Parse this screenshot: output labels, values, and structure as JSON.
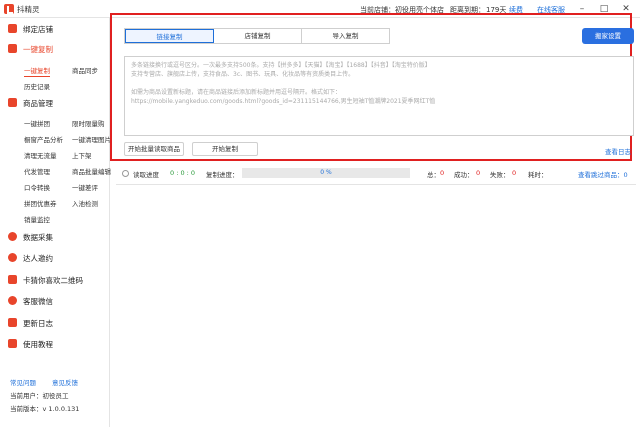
{
  "app": {
    "title": "抖精灵"
  },
  "titlebar": {
    "current_shop_label": "当前店铺：初役用亮个体店",
    "expire_label": "距离到期：",
    "expire_days": "179天",
    "renew": "续费",
    "online_service": "在线客服"
  },
  "sidebar": {
    "bind_shop": "绑定店铺",
    "one_click_copy": "一键复制",
    "copy_subs": [
      "一键复制",
      "商品同步",
      "历史记录"
    ],
    "product_manage": "商品管理",
    "product_subs": [
      [
        "一键拼团",
        "限时限量购"
      ],
      [
        "橱窗产品分析",
        "一键清理图片"
      ],
      [
        "清理无流量",
        "上下架"
      ],
      [
        "代发管理",
        "商品批量编辑"
      ],
      [
        "口令转换",
        "一键差评"
      ],
      [
        "拼团优惠券",
        "入池检测"
      ],
      [
        "销量监控",
        ""
      ]
    ],
    "data_collect": "数据采集",
    "talent_invite": "达人邀约",
    "qrcode": "卡猜你喜欢二维码",
    "service_wechat": "客服微信",
    "update_log": "更新日志",
    "tutorial": "使用教程",
    "faq": "常见问题",
    "feedback": "意见反馈",
    "current_user": "当前用户：初役员工",
    "version": "当前版本：v 1.0.0.131"
  },
  "main": {
    "tabs": [
      "链接复制",
      "店铺复制",
      "导入复制"
    ],
    "move_setting": "搬家设置",
    "textarea_placeholder": [
      "多条链接换行或逗号区分。一次最多支持500条。支持【拼多多】【天猫】【淘宝】【1688】【抖音】【淘宝特价版】",
      "支持专营店、旗舰店上传，支持食品、3c、图书、玩具、化妆品等有资质类目上传。",
      "",
      "如需为商品设置新标题，请在商品链接后添加新标题并用逗号隔开。格式如下：",
      "https://mobile.yangkeduo.com/goods.html?goods_id=231115144766,男生短袖T恤潮牌2021夏季网红T恤"
    ],
    "batch_read_button": "开始批量读取商品",
    "start_copy_button": "开始复制",
    "view_log": "查看日志",
    "progress": {
      "read_label": "读取进度",
      "read_value": "0 : 0 : 0",
      "copy_label": "复制进度：",
      "copy_percent": "0 %",
      "total_label": "总：",
      "total": "0",
      "success_label": "成功：",
      "success": "0",
      "fail_label": "失败：",
      "fail": "0",
      "time_label": "耗时：",
      "time": "",
      "skipped_link": "查看跳过商品：0"
    }
  },
  "colors": {
    "accent": "#e8452b",
    "link": "#1e6fd9",
    "primary": "#2a6fe0",
    "highlight": "#e02020"
  }
}
